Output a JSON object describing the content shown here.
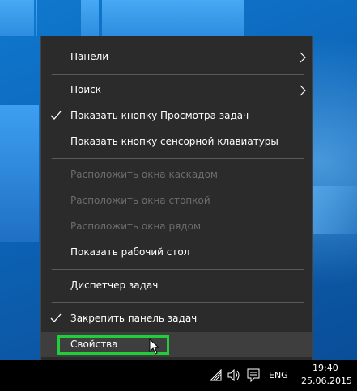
{
  "menu": {
    "items": [
      {
        "label": "Панели",
        "submenu": true
      },
      {
        "label": "Поиск",
        "submenu": true
      },
      {
        "label": "Показать кнопку Просмотра задач",
        "checked": true
      },
      {
        "label": "Показать кнопку сенсорной клавиатуры"
      },
      {
        "label": "Расположить окна каскадом",
        "disabled": true
      },
      {
        "label": "Расположить окна стопкой",
        "disabled": true
      },
      {
        "label": "Расположить окна рядом",
        "disabled": true
      },
      {
        "label": "Показать рабочий стол"
      },
      {
        "label": "Диспетчер задач"
      },
      {
        "label": "Закрепить панель задач",
        "checked": true
      },
      {
        "label": "Свойства",
        "highlighted": true
      }
    ]
  },
  "taskbar": {
    "language": "ENG",
    "time": "19:40",
    "date": "25.06.2015"
  },
  "colors": {
    "menu_bg": "#2b2b2b",
    "highlight_border": "#1ecf39",
    "taskbar_bg": "#000000"
  },
  "icons": [
    "chevron-right-icon",
    "checkmark-icon",
    "mouse-cursor-icon",
    "wifi-icon",
    "volume-icon",
    "notification-icon"
  ]
}
